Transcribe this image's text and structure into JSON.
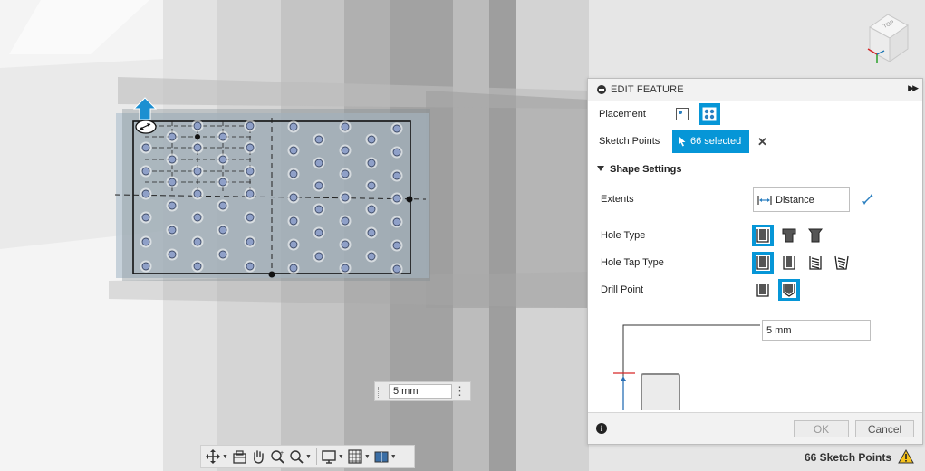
{
  "dimension_input": {
    "value": "5 mm"
  },
  "status": {
    "text": "66 Sketch Points"
  },
  "viewcube": {
    "label": "TOP"
  },
  "panel": {
    "title": "EDIT FEATURE",
    "placement_label": "Placement",
    "sketch_points_label": "Sketch Points",
    "sketch_points_value": "66 selected",
    "shape_settings_label": "Shape Settings",
    "extents_label": "Extents",
    "extents_value": "Distance",
    "hole_type_label": "Hole Type",
    "hole_tap_type_label": "Hole Tap Type",
    "drill_point_label": "Drill Point",
    "depth_value": "5 mm",
    "ok_label": "OK",
    "cancel_label": "Cancel"
  },
  "colors": {
    "accent": "#0696d7",
    "panel_bg": "#ffffff",
    "plate": "#9aa3a8",
    "hole": "#8fa0c8"
  }
}
